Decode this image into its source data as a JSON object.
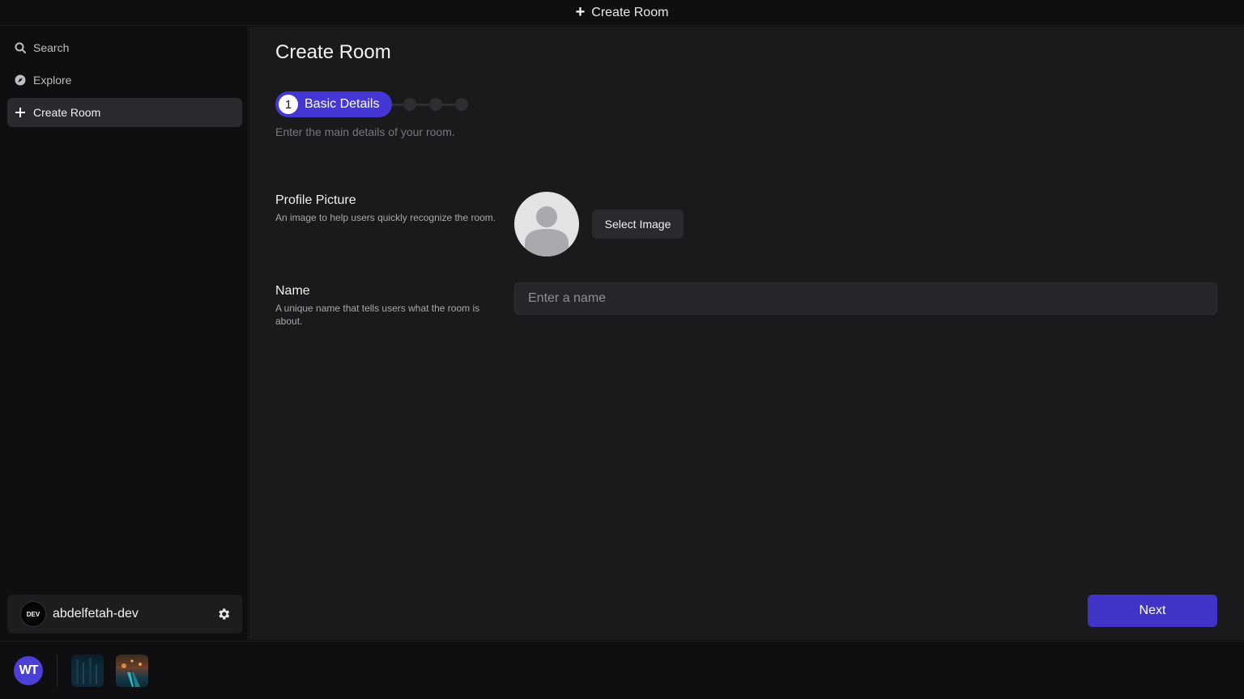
{
  "titlebar": {
    "icon": "plus-icon",
    "title": "Create Room"
  },
  "sidebar": {
    "items": [
      {
        "label": "Search",
        "icon": "search-icon"
      },
      {
        "label": "Explore",
        "icon": "compass-icon"
      },
      {
        "label": "Create Room",
        "icon": "plus-icon",
        "active": true
      }
    ],
    "user": {
      "avatar_text": "DEV",
      "name": "abdelfetah-dev",
      "settings_icon": "gear-icon"
    }
  },
  "main": {
    "title": "Create Room",
    "stepper": {
      "current_step": "1",
      "current_label": "Basic Details",
      "total_steps": 4
    },
    "hint": "Enter the main details of your room.",
    "profile": {
      "label": "Profile Picture",
      "description": "An image to help users quickly recognize the room.",
      "button": "Select Image"
    },
    "name": {
      "label": "Name",
      "description": "A unique name that tells users what the room is about.",
      "placeholder": "Enter a name",
      "value": ""
    },
    "next_button": "Next"
  },
  "dock": {
    "logo_text": "WT"
  },
  "colors": {
    "accent": "#4536d6",
    "background": "#1a1a1d",
    "sidebar": "#0f0f11"
  }
}
